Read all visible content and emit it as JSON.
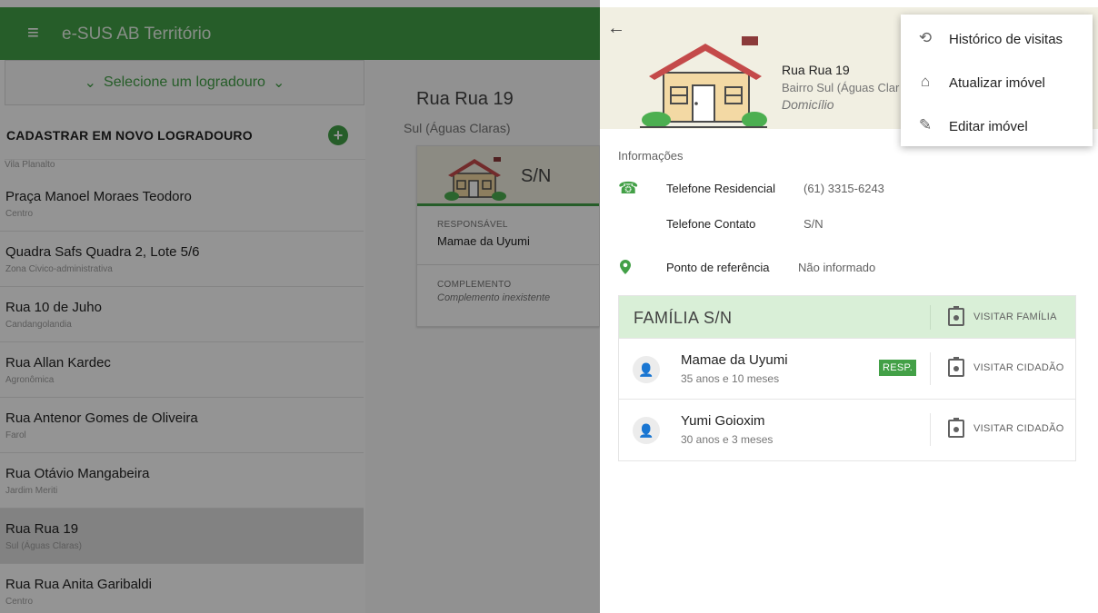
{
  "app": {
    "title": "e-SUS AB Território"
  },
  "left": {
    "selector_label": "Selecione um logradouro",
    "cadastrar_label": "CADASTRAR EM NOVO LOGRADOURO",
    "partial_item": "Vila Planalto",
    "streets": [
      {
        "name": "Praça Manoel Moraes Teodoro",
        "district": "Centro"
      },
      {
        "name": "Quadra Safs Quadra 2, Lote 5/6",
        "district": "Zona Civico-administrativa"
      },
      {
        "name": "Rua 10 de Juho",
        "district": "Candangolandia"
      },
      {
        "name": "Rua Allan Kardec",
        "district": "Agronômica"
      },
      {
        "name": "Rua Antenor Gomes de Oliveira",
        "district": "Farol"
      },
      {
        "name": "Rua Otávio Mangabeira",
        "district": "Jardim Meriti"
      },
      {
        "name": "Rua Rua 19",
        "district": "Sul (Águas Claras)"
      },
      {
        "name": "Rua Rua Anita Garibaldi",
        "district": "Centro"
      }
    ]
  },
  "middle": {
    "title": "Rua Rua 19",
    "subtitle": "Sul (Águas Claras)",
    "card": {
      "number": "S/N",
      "responsavel_label": "RESPONSÁVEL",
      "responsavel_value": "Mamae da Uyumi",
      "complemento_label": "COMPLEMENTO",
      "complemento_value": "Complemento inexistente"
    }
  },
  "panel": {
    "address": "Rua Rua 19",
    "bairro": "Bairro Sul (Águas Clar",
    "type": "Domicílio",
    "info_label": "Informações",
    "fields": {
      "tel_res_label": "Telefone Residencial",
      "tel_res_value": "(61) 3315-6243",
      "tel_contato_label": "Telefone Contato",
      "tel_contato_value": "S/N",
      "ref_label": "Ponto de referência",
      "ref_value": "Não informado"
    },
    "family": {
      "title": "FAMÍLIA S/N",
      "visit_family_label": "VISITAR FAMÍLIA",
      "members": [
        {
          "name": "Mamae da Uyumi",
          "age": "35 anos e 10 meses",
          "badge": "RESP.",
          "visit_label": "VISITAR CIDADÃO"
        },
        {
          "name": "Yumi Goioxim",
          "age": "30 anos e 3 meses",
          "badge": "",
          "visit_label": "VISITAR CIDADÃO"
        }
      ]
    }
  },
  "menu": {
    "items": [
      {
        "label": "Histórico de visitas",
        "icon": "history-icon"
      },
      {
        "label": "Atualizar imóvel",
        "icon": "house-update-icon"
      },
      {
        "label": "Editar imóvel",
        "icon": "pencil-icon"
      }
    ]
  },
  "colors": {
    "primary": "#43a047",
    "header_bg": "#f1efe2",
    "family_bg": "#d9efd7"
  }
}
